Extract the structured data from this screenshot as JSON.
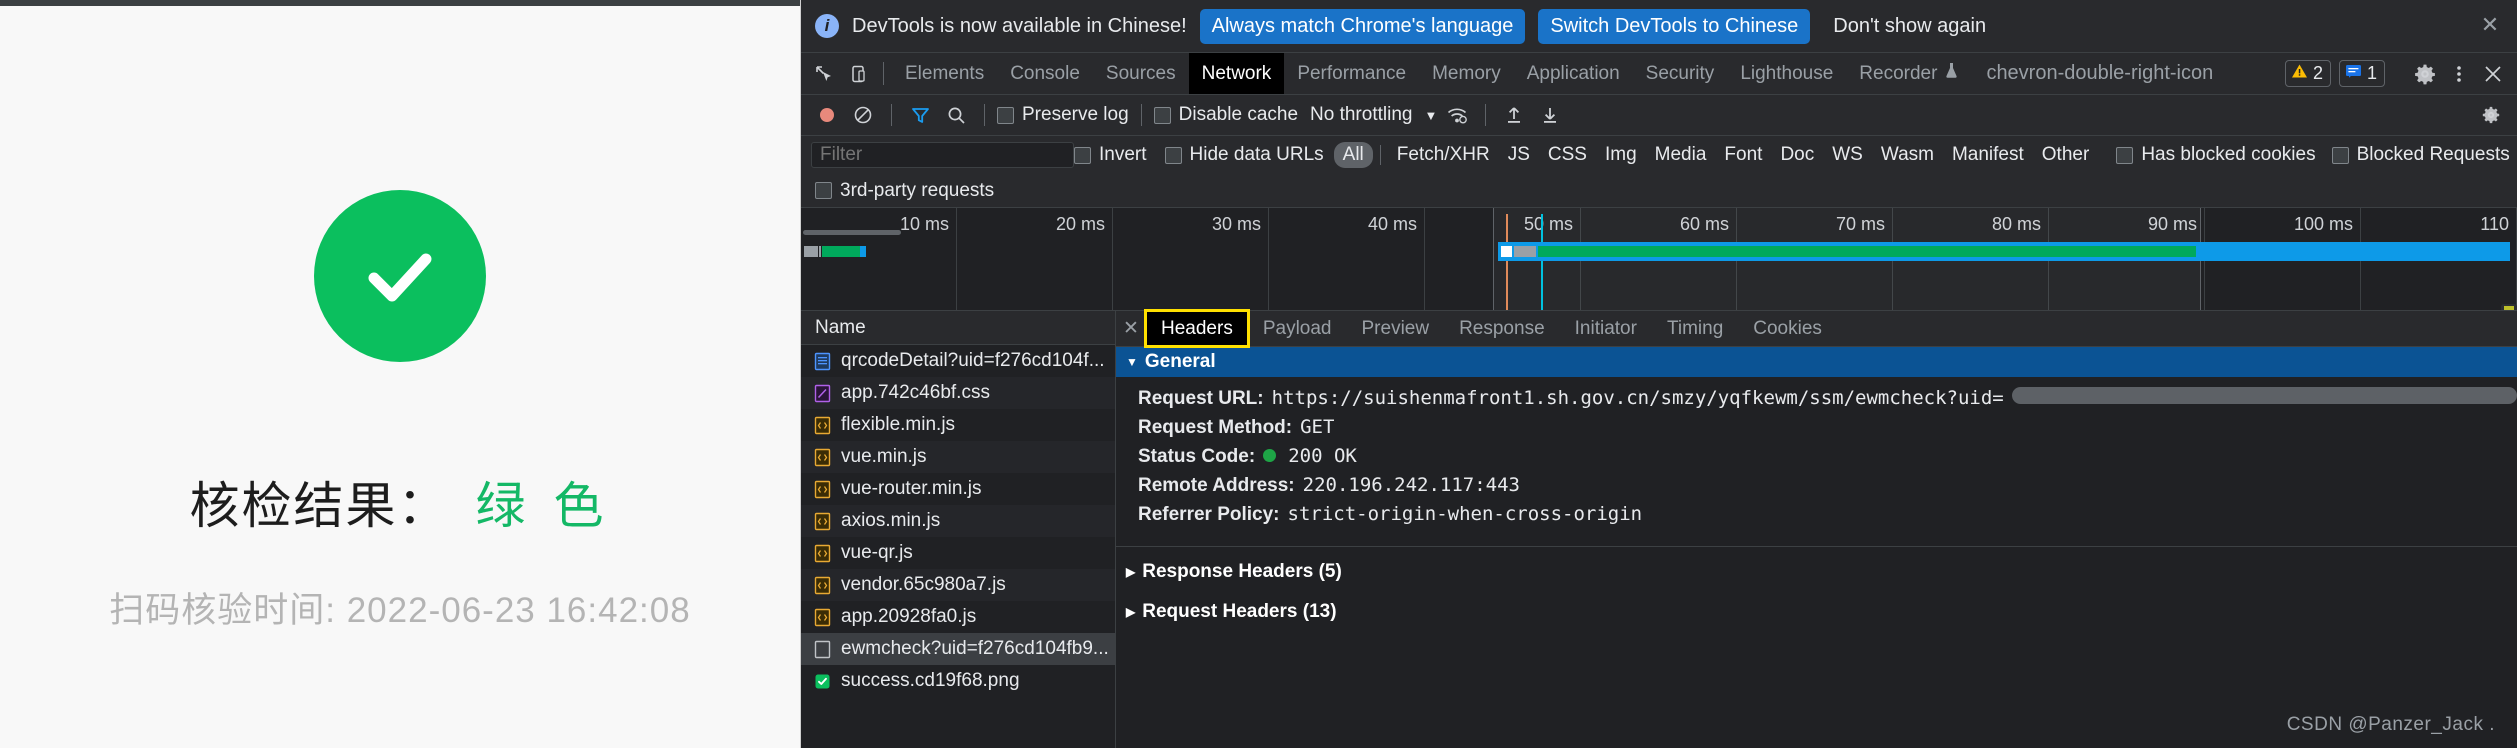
{
  "page": {
    "status_icon": "green-check-circle",
    "result_label": "核检结果：",
    "result_value": "绿 色",
    "scan_time": "扫码核验时间: 2022-06-23 16:42:08",
    "accent_green": "#0bbf5e",
    "result_green": "#14b866"
  },
  "banner": {
    "icon": "info-icon",
    "message": "DevTools is now available in Chinese!",
    "primary_button": "Always match Chrome's language",
    "secondary_button": "Switch DevTools to Chinese",
    "dismiss_link": "Don't show again",
    "close_icon": "close-icon",
    "button_color": "#1a73c8"
  },
  "tabbar": {
    "inspect_icon": "inspect-element-icon",
    "device_icon": "device-toolbar-icon",
    "tabs": [
      {
        "label": "Elements",
        "active": false
      },
      {
        "label": "Console",
        "active": false
      },
      {
        "label": "Sources",
        "active": false
      },
      {
        "label": "Network",
        "active": true
      },
      {
        "label": "Performance",
        "active": false
      },
      {
        "label": "Memory",
        "active": false
      },
      {
        "label": "Application",
        "active": false
      },
      {
        "label": "Security",
        "active": false
      },
      {
        "label": "Lighthouse",
        "active": false
      },
      {
        "label": "Recorder",
        "active": false,
        "icon": "flask-icon"
      }
    ],
    "more_tabs_icon": "chevron-double-right-icon",
    "warning_count": "2",
    "message_count": "1",
    "settings_icon": "gear-icon",
    "kebab_icon": "more-vertical-icon",
    "close_icon": "close-icon"
  },
  "net_toolbar": {
    "record_icon": "record-button",
    "clear_icon": "clear-icon",
    "filter_icon": "filter-funnel-icon",
    "search_icon": "search-icon",
    "preserve_log": "Preserve log",
    "disable_cache": "Disable cache",
    "throttling": "No throttling",
    "caret": "▼",
    "network_conditions_icon": "wifi-settings-icon",
    "import_icon": "upload-arrow-icon",
    "export_icon": "download-arrow-icon",
    "right_settings_icon": "network-settings-gear-icon"
  },
  "filter_row": {
    "placeholder": "Filter",
    "value": "",
    "invert": "Invert",
    "hide_data_urls": "Hide data URLs",
    "types": [
      {
        "label": "All",
        "active": true
      },
      {
        "label": "Fetch/XHR",
        "active": false
      },
      {
        "label": "JS",
        "active": false
      },
      {
        "label": "CSS",
        "active": false
      },
      {
        "label": "Img",
        "active": false
      },
      {
        "label": "Media",
        "active": false
      },
      {
        "label": "Font",
        "active": false
      },
      {
        "label": "Doc",
        "active": false
      },
      {
        "label": "WS",
        "active": false
      },
      {
        "label": "Wasm",
        "active": false
      },
      {
        "label": "Manifest",
        "active": false
      },
      {
        "label": "Other",
        "active": false
      }
    ],
    "has_blocked_cookies": "Has blocked cookies",
    "blocked_requests": "Blocked Requests",
    "third_party_requests": "3rd-party requests"
  },
  "overview": {
    "ticks": [
      "10 ms",
      "20 ms",
      "30 ms",
      "40 ms",
      "50 ms",
      "60 ms",
      "70 ms",
      "80 ms",
      "90 ms",
      "100 ms",
      "110"
    ],
    "bars": [
      {
        "left_pct": 0.2,
        "segments": [
          {
            "left_pct": 0,
            "width_pct": 2.4,
            "color": "#9aa0a6"
          },
          {
            "left_pct": 2.6,
            "width_pct": 1.5,
            "color": "#9aa0a6"
          },
          {
            "left_pct": 4.3,
            "width_pct": 0.6,
            "color": "#9aa0a6"
          },
          {
            "left_pct": 5.2,
            "width_pct": 11.0,
            "color": "#00a95c"
          },
          {
            "left_pct": 16.2,
            "width_pct": 1.8,
            "color": "#0d9ae8"
          }
        ]
      },
      {
        "left_pct": 40.7,
        "segments": [
          {
            "left_pct": 0,
            "width_pct": 0.9,
            "color": "#ffffff"
          },
          {
            "left_pct": 1.0,
            "width_pct": 1.6,
            "color": "#9aa0a6"
          },
          {
            "left_pct": 2.7,
            "width_pct": 38.5,
            "color": "#00a95c"
          }
        ]
      }
    ],
    "selection_left_pct": 40.3,
    "selection_right_pct": 81.6,
    "dom_content_line_color": "#e08a5a",
    "load_line_color": "#00c2e0"
  },
  "requests": {
    "column_header": "Name",
    "rows": [
      {
        "name": "qrcodeDetail?uid=f276cd104f...",
        "type": "doc",
        "selected": false
      },
      {
        "name": "app.742c46bf.css",
        "type": "css",
        "selected": false
      },
      {
        "name": "flexible.min.js",
        "type": "js",
        "selected": false
      },
      {
        "name": "vue.min.js",
        "type": "js",
        "selected": false
      },
      {
        "name": "vue-router.min.js",
        "type": "js",
        "selected": false
      },
      {
        "name": "axios.min.js",
        "type": "js",
        "selected": false
      },
      {
        "name": "vue-qr.js",
        "type": "js",
        "selected": false
      },
      {
        "name": "vendor.65c980a7.js",
        "type": "js",
        "selected": false
      },
      {
        "name": "app.20928fa0.js",
        "type": "js",
        "selected": false
      },
      {
        "name": "ewmcheck?uid=f276cd104fb9...",
        "type": "xhr",
        "selected": true
      },
      {
        "name": "success.cd19f68.png",
        "type": "img",
        "selected": false
      }
    ]
  },
  "detail": {
    "close_icon": "close-icon",
    "tabs": [
      {
        "label": "Headers",
        "active": true,
        "annotated": true
      },
      {
        "label": "Payload",
        "active": false
      },
      {
        "label": "Preview",
        "active": false
      },
      {
        "label": "Response",
        "active": false
      },
      {
        "label": "Initiator",
        "active": false
      },
      {
        "label": "Timing",
        "active": false
      },
      {
        "label": "Cookies",
        "active": false
      }
    ],
    "annotation_color": "#ffe000",
    "general": {
      "title": "General",
      "tri": "▼",
      "highlight_color": "#0b5394",
      "request_url_key": "Request URL:",
      "request_url_value": "https://suishenmafront1.sh.gov.cn/smzy/yqfkewm/ssm/ewmcheck?uid=",
      "request_method_key": "Request Method:",
      "request_method_value": "GET",
      "status_code_key": "Status Code:",
      "status_code_value": "200 OK",
      "status_dot_color": "#1ea446",
      "remote_address_key": "Remote Address:",
      "remote_address_value": "220.196.242.117:443",
      "referrer_policy_key": "Referrer Policy:",
      "referrer_policy_value": "strict-origin-when-cross-origin"
    },
    "response_headers": "Response Headers (5)",
    "request_headers": "Request Headers (13)",
    "collapsed_tri": "▶"
  },
  "watermark": "CSDN @Panzer_Jack ."
}
